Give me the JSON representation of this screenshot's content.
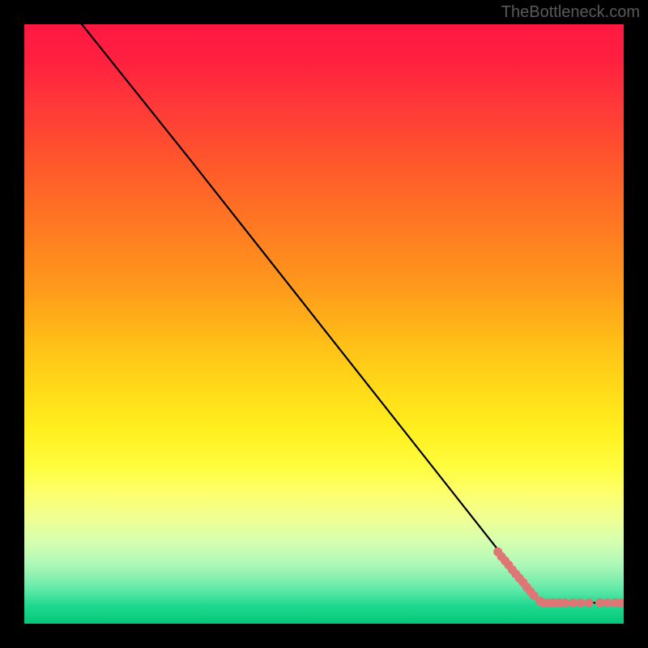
{
  "watermark": "TheBottleneck.com",
  "chart_data": {
    "type": "line",
    "title": "",
    "xlabel": "",
    "ylabel": "",
    "xlim": [
      0,
      100
    ],
    "ylim": [
      0,
      100
    ],
    "grid": false,
    "series": [
      {
        "name": "curve",
        "style": "line",
        "color": "#000000",
        "x": [
          8,
          28,
          86,
          99
        ],
        "values": [
          102,
          77,
          3.5,
          3.5
        ]
      },
      {
        "name": "points-diagonal",
        "style": "scatter",
        "color": "#de7676",
        "x": [
          79.0,
          79.6,
          80.2,
          80.8,
          81.4,
          82.0,
          82.6,
          83.2,
          83.8,
          84.4,
          85.0,
          86.0
        ],
        "values": [
          12.0,
          11.2,
          10.5,
          9.8,
          9.0,
          8.3,
          7.6,
          6.9,
          6.1,
          5.4,
          4.7,
          3.8
        ]
      },
      {
        "name": "points-flat",
        "style": "scatter",
        "color": "#de7676",
        "x": [
          86.5,
          87.5,
          88.3,
          89.2,
          90.2,
          91.5,
          92.8,
          94.2,
          96.0,
          97.3,
          98.6,
          99.5
        ],
        "values": [
          3.5,
          3.5,
          3.5,
          3.5,
          3.5,
          3.5,
          3.5,
          3.5,
          3.5,
          3.5,
          3.5,
          3.5
        ]
      }
    ],
    "gradient_stops": [
      {
        "pos": 0,
        "color": "#ff1842"
      },
      {
        "pos": 25,
        "color": "#ff6a26"
      },
      {
        "pos": 50,
        "color": "#ffc218"
      },
      {
        "pos": 75,
        "color": "#fcff58"
      },
      {
        "pos": 90,
        "color": "#b0f8b8"
      },
      {
        "pos": 100,
        "color": "#04c878"
      }
    ]
  }
}
